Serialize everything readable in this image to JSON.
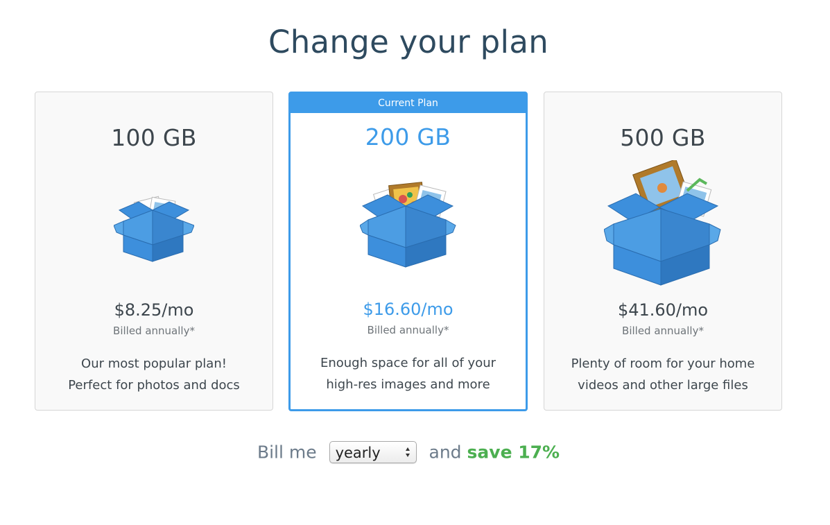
{
  "page": {
    "title": "Change your plan"
  },
  "plans": [
    {
      "storage": "100 GB",
      "price": "$8.25/mo",
      "billing_note": "Billed annually*",
      "description": [
        "Our most popular plan!",
        "Perfect for photos and docs"
      ]
    },
    {
      "ribbon": "Current Plan",
      "storage": "200 GB",
      "price": "$16.60/mo",
      "billing_note": "Billed annually*",
      "description": [
        "Enough space for all of your",
        "high-res images and more"
      ]
    },
    {
      "storage": "500 GB",
      "price": "$41.60/mo",
      "billing_note": "Billed annually*",
      "description": [
        "Plenty of room for your home",
        "videos and other large files"
      ]
    }
  ],
  "billing": {
    "prefix": "Bill me",
    "selected_period": "yearly",
    "middle": "and",
    "savings": "save 17%"
  },
  "colors": {
    "accent": "#3d9be9",
    "savings": "#4caf50",
    "title": "#2e4a5f",
    "box_blue": "#3d8fdc"
  },
  "icons": [
    "open-box-icon",
    "select-arrows-icon"
  ]
}
